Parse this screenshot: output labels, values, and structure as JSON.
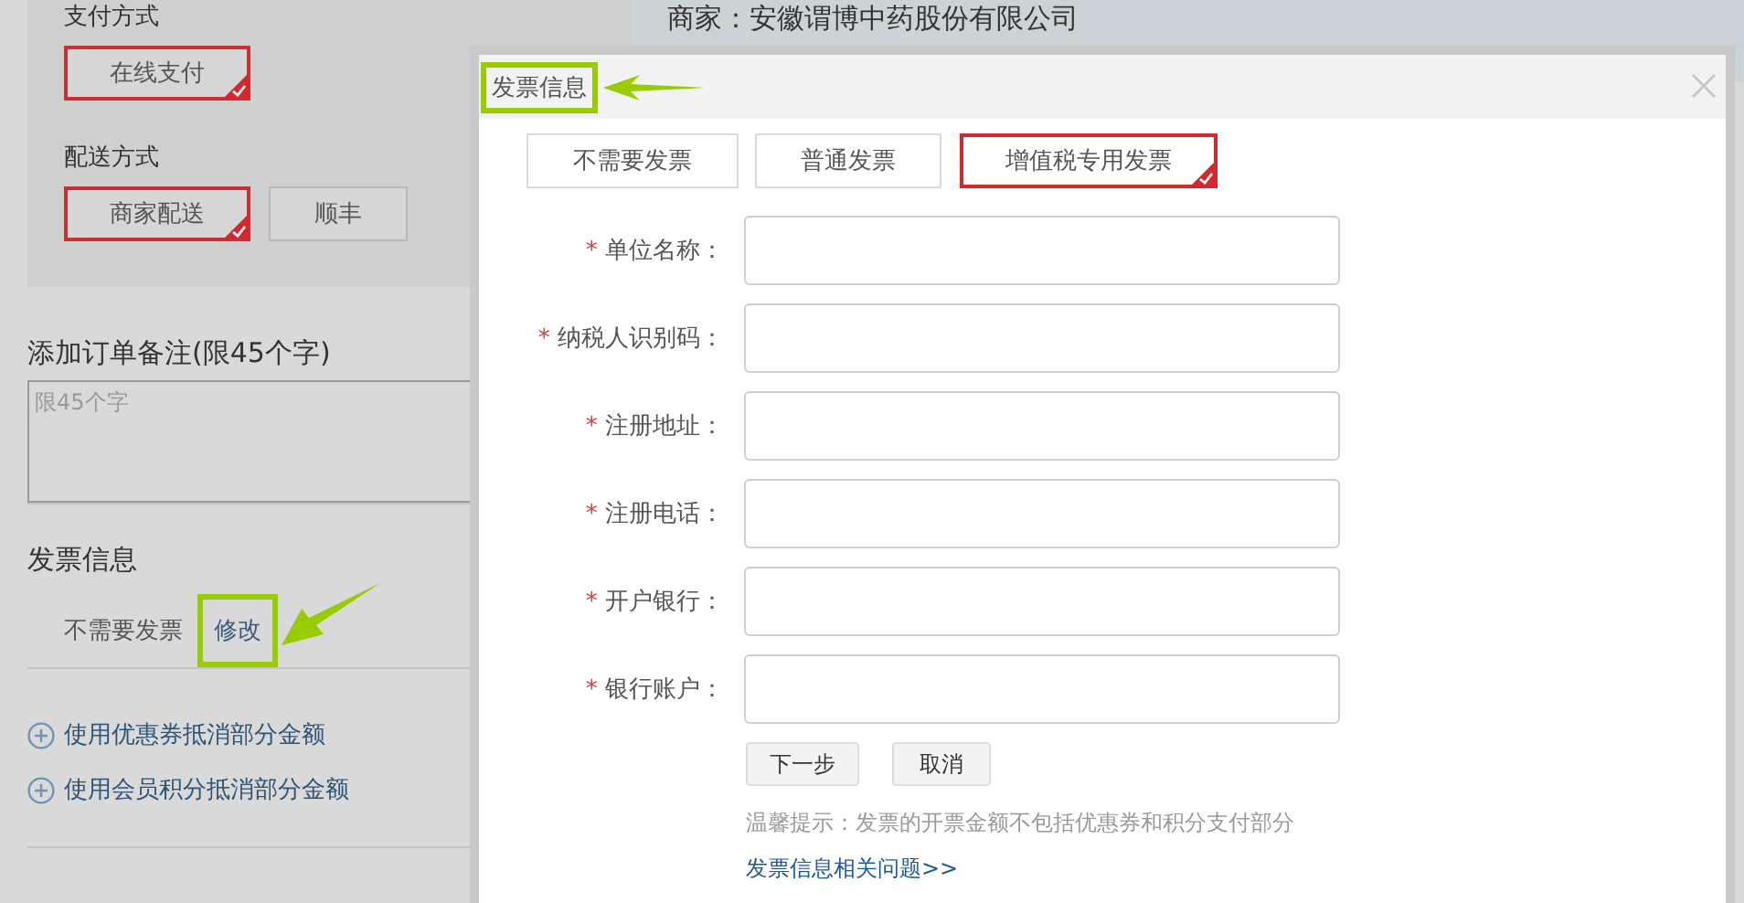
{
  "background": {
    "payment_label": "支付方式",
    "payment_options": [
      {
        "label": "在线支付",
        "selected": true
      }
    ],
    "delivery_label": "配送方式",
    "delivery_options": [
      {
        "label": "商家配送",
        "selected": true
      },
      {
        "label": "顺丰",
        "selected": false
      }
    ],
    "merchant": "商家：安徽谓博中药股份有限公司",
    "remark_title": "添加订单备注(限45个字)",
    "remark_placeholder": "限45个字",
    "invoice_title": "发票信息",
    "invoice_value": "不需要发票",
    "invoice_edit": "修改",
    "discounts": [
      "使用优惠券抵消部分金额",
      "使用会员积分抵消部分金额"
    ]
  },
  "dialog": {
    "title": "发票信息",
    "invoice_types": [
      {
        "label": "不需要发票",
        "selected": false
      },
      {
        "label": "普通发票",
        "selected": false
      },
      {
        "label": "增值税专用发票",
        "selected": true
      }
    ],
    "fields": [
      {
        "mark": "*",
        "label": "单位名称："
      },
      {
        "mark": "*",
        "label": "纳税人识别码："
      },
      {
        "mark": "*",
        "label": "注册地址："
      },
      {
        "mark": "*",
        "label": "注册电话："
      },
      {
        "mark": "*",
        "label": "开户银行："
      },
      {
        "mark": "*",
        "label": "银行账户："
      }
    ],
    "buttons": [
      "下一步",
      "取消"
    ],
    "tip": "温馨提示：发票的开票金额不包括优惠券和积分支付部分",
    "help_link": "发票信息相关问题>>"
  }
}
